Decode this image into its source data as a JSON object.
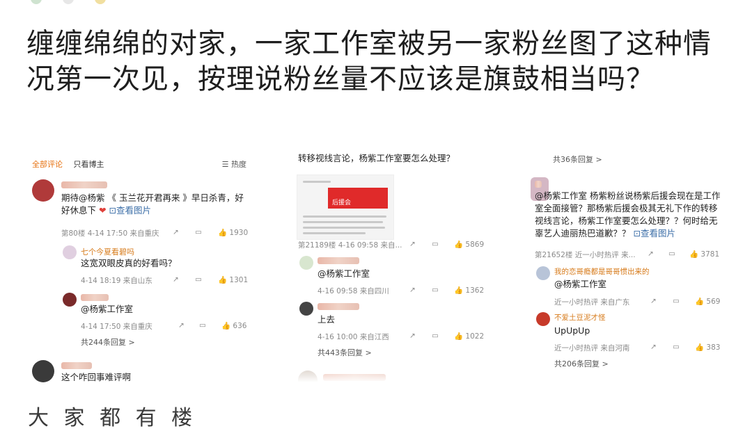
{
  "post": {
    "text": "缠缠绵绵的对家，一家工作室被另一家粉丝图了这种情况第一次见，按理说粉丝量不应该是旗鼓相当吗？"
  },
  "screenshot1": {
    "tabs": [
      "全部评论",
      "只看博主"
    ],
    "sort": "热度",
    "comment1": {
      "text": "期待@杨紫 《 玉兰花开君再来 》早日杀青，好好休息下",
      "mention": "@杨紫",
      "show_image": "查看图片",
      "meta": "第80楼  4-14 17:50  来自重庆",
      "likes": "1930"
    },
    "reply1": {
      "name": "七个今夏看碧吗",
      "text": "这宽双眼皮真的好看吗？",
      "meta": "4-14 18:19  来自山东",
      "likes": "1301"
    },
    "reply2": {
      "text": "@杨紫工作室",
      "meta": "4-14 17:50  来自重庆",
      "likes": "636"
    },
    "more_replies": "共244条回复 >",
    "comment2": {
      "text": "这个咋回事难评啊"
    }
  },
  "screenshot2": {
    "top_text": "转移视线言论，杨紫工作室要怎么处理？",
    "image_title": "后援会",
    "meta_main": "第21189楼  4-16 09:58  来自...",
    "likes_main": "5869",
    "reply1": {
      "text": "@杨紫工作室",
      "meta": "4-16 09:58  来自四川",
      "likes": "1362"
    },
    "reply2": {
      "text": "上去",
      "meta": "4-16 10:00  来自江西",
      "likes": "1022"
    },
    "more_replies": "共443条回复 >"
  },
  "screenshot3": {
    "top_more": "共36条回复 >",
    "comment": {
      "text": "@杨紫工作室 杨紫粉丝说杨紫后援会现在是工作室全面接管？那杨紫后援会极其无礼下作的转移视线言论，杨紫工作室要怎么处理？？何时给无辜艺人迪丽热巴道歉？？",
      "show_image": "查看图片",
      "meta": "第21652楼  近一小时热评  来...",
      "likes": "3781"
    },
    "reply1": {
      "name": "我的恋哥瘾都是哥哥惯出来的",
      "text": "@杨紫工作室",
      "meta": "近一小时热评  来自广东",
      "likes": "569"
    },
    "reply2": {
      "name": "不爱土豆泥才怪",
      "text": "UpUpUp",
      "meta": "近一小时热评  来自河南",
      "likes": "383"
    },
    "more_replies": "共206条回复 >"
  },
  "cutoff_text": "大 家 都 有 楼"
}
